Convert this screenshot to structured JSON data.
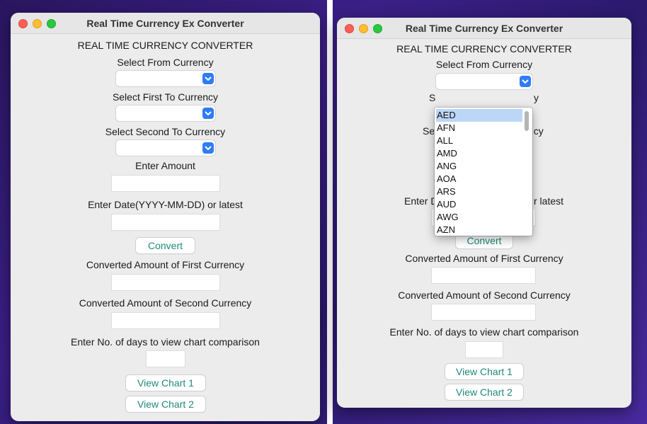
{
  "window_title": "Real Time Currency Ex Converter",
  "heading": "REAL TIME CURRENCY CONVERTER",
  "labels": {
    "from_currency": "Select From Currency",
    "first_to_currency": "Select First To Currency",
    "second_to_currency": "Select Second To Currency",
    "amount": "Enter Amount",
    "date": "Enter Date(YYYY-MM-DD) or latest",
    "converted_first": "Converted Amount of First Currency",
    "converted_second": "Converted Amount of Second Currency",
    "days": "Enter No. of days to view chart comparison"
  },
  "buttons": {
    "convert": "Convert",
    "chart1": "View Chart 1",
    "chart2": "View Chart 2"
  },
  "right_partial": {
    "first_to_tail": "y",
    "first_to_head": "S",
    "second_to_head": "Se",
    "second_to_tail": "ncy",
    "date_head": "Enter D",
    "date_tail": "r latest"
  },
  "currency_dropdown": {
    "options": [
      "AED",
      "AFN",
      "ALL",
      "AMD",
      "ANG",
      "AOA",
      "ARS",
      "AUD",
      "AWG",
      "AZN"
    ],
    "highlighted": "AED"
  },
  "colors": {
    "accent_blue": "#2f7cf6",
    "button_text": "#1f8a7a",
    "highlight": "#bcd6f7"
  }
}
